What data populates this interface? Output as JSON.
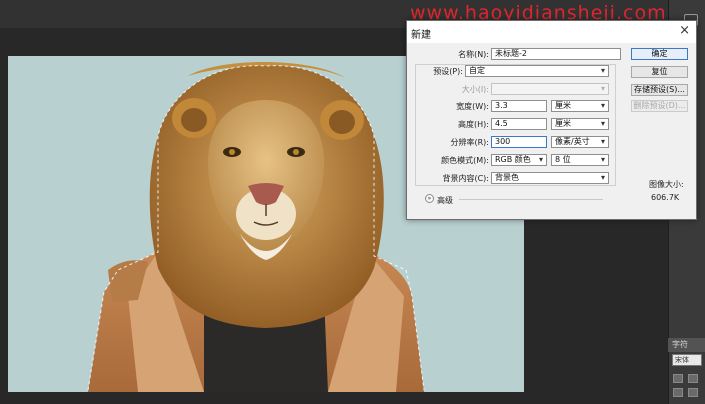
{
  "watermark": "www.haoyidiansheji.com",
  "dialog": {
    "title": "新建",
    "close_glyph": "×",
    "name_label": "名称(N):",
    "name_value": "未标题-2",
    "preset_label": "预设(P):",
    "preset_value": "自定",
    "size_label": "大小(I):",
    "width_label": "宽度(W):",
    "width_value": "3.3",
    "width_unit": "厘米",
    "height_label": "高度(H):",
    "height_value": "4.5",
    "height_unit": "厘米",
    "resolution_label": "分辨率(R):",
    "resolution_value": "300",
    "resolution_unit": "像素/英寸",
    "color_mode_label": "颜色模式(M):",
    "color_mode_value": "RGB 颜色",
    "bit_depth_value": "8 位",
    "background_label": "背景内容(C):",
    "background_value": "背景色",
    "advanced_label": "高级",
    "buttons": {
      "ok": "确定",
      "reset": "复位",
      "save_preset": "存储预设(S)...",
      "delete_preset": "删除预设(D)..."
    },
    "image_size_label": "图像大小:",
    "image_size_value": "606.7K"
  },
  "right_panel": {
    "tab_label": "字符",
    "font_field": "宋体"
  },
  "colors": {
    "canvas_bg": "#b9d0d0",
    "app_bg": "#282828",
    "watermark": "#e0262e",
    "accent_border": "#3a78c8"
  }
}
